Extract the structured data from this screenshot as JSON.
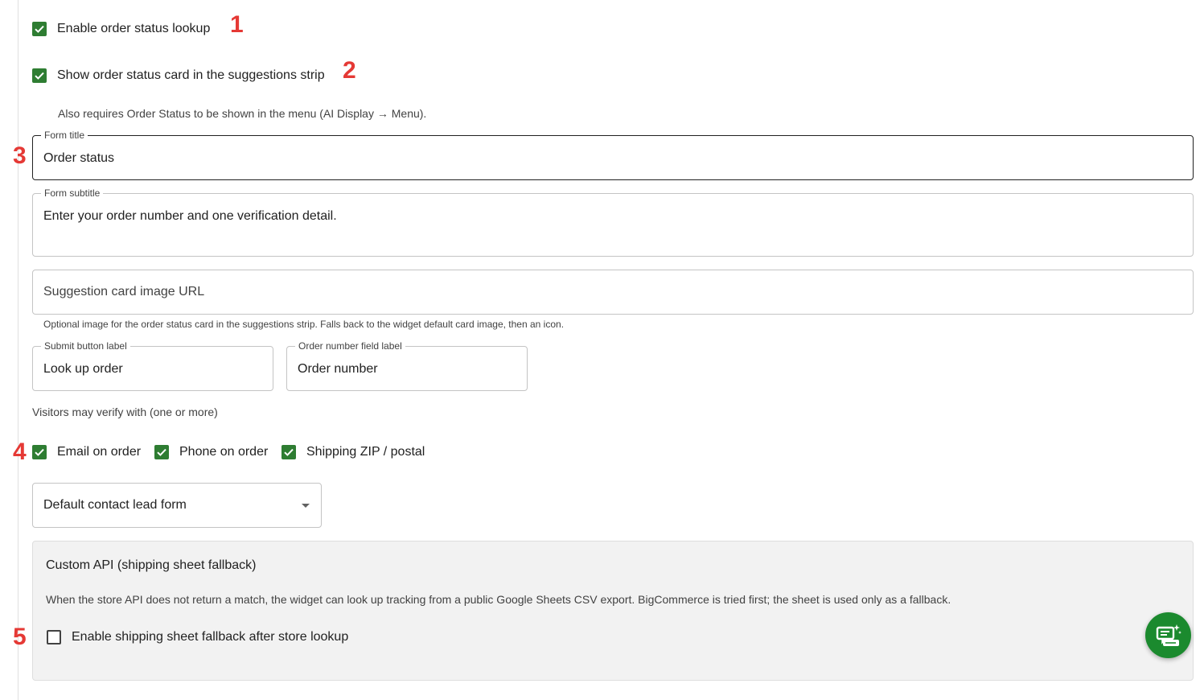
{
  "settings": {
    "enable_lookup": {
      "label": "Enable order status lookup",
      "checked": true
    },
    "show_card": {
      "label": "Show order status card in the suggestions strip",
      "checked": true
    },
    "show_card_hint": "Also requires Order Status to be shown in the menu (AI Display → Menu).",
    "form_title": {
      "legend": "Form title",
      "value": "Order status"
    },
    "form_subtitle": {
      "legend": "Form subtitle",
      "value": "Enter your order number and one verification detail."
    },
    "image_url": {
      "placeholder": "Suggestion card image URL",
      "hint": "Optional image for the order status card in the suggestions strip. Falls back to the widget default card image, then an icon."
    },
    "submit_label": {
      "legend": "Submit button label",
      "value": "Look up order"
    },
    "order_number_label": {
      "legend": "Order number field label",
      "value": "Order number"
    },
    "verify_heading": "Visitors may verify with (one or more)",
    "verify_options": [
      {
        "label": "Email on order",
        "checked": true
      },
      {
        "label": "Phone on order",
        "checked": true
      },
      {
        "label": "Shipping ZIP / postal",
        "checked": true
      }
    ],
    "lead_form_select": {
      "selected": "Default contact lead form"
    },
    "custom_api": {
      "title": "Custom API (shipping sheet fallback)",
      "description": "When the store API does not return a match, the widget can look up tracking from a public Google Sheets CSV export. BigCommerce is tried first; the sheet is used only as a fallback.",
      "enable_fallback": {
        "label": "Enable shipping sheet fallback after store lookup",
        "checked": false
      }
    }
  },
  "annotations": [
    "1",
    "2",
    "3",
    "4",
    "5"
  ],
  "colors": {
    "check_green": "#2e7d32",
    "annotation_red": "#e53935",
    "fab_green": "#1b8a2e",
    "panel_bg": "#f2f2f2"
  },
  "icons": {
    "chat_fab": "chat-sparkle-icon",
    "select_arrow": "caret-down-icon"
  }
}
